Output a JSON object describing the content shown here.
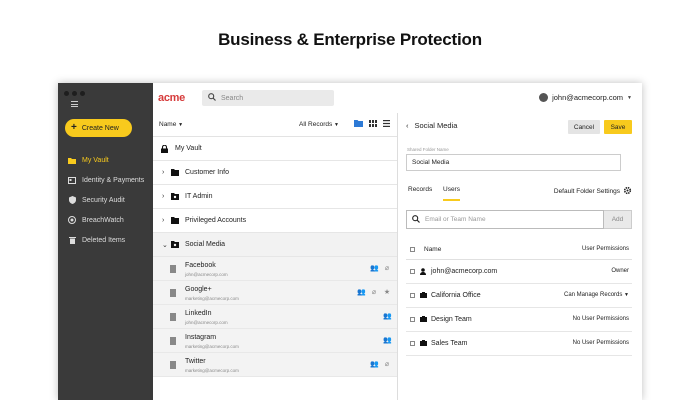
{
  "page_title": "Business & Enterprise Protection",
  "sidebar": {
    "create_label": "Create New",
    "items": [
      {
        "label": "My Vault",
        "icon": "folder-icon",
        "active": true
      },
      {
        "label": "Identity & Payments",
        "icon": "id-card-icon"
      },
      {
        "label": "Security Audit",
        "icon": "shield-icon"
      },
      {
        "label": "BreachWatch",
        "icon": "breachwatch-icon"
      },
      {
        "label": "Deleted Items",
        "icon": "trash-icon"
      }
    ]
  },
  "topbar": {
    "logo": "acme",
    "search_placeholder": "Search",
    "user_email": "john@acmecorp.com"
  },
  "list": {
    "sort_label": "Name",
    "filter_label": "All Records",
    "my_vault": "My Vault",
    "folders": [
      {
        "label": "Customer Info",
        "icon": "folder-icon"
      },
      {
        "label": "IT Admin",
        "icon": "shared-folder-icon"
      },
      {
        "label": "Privileged Accounts",
        "icon": "folder-icon"
      },
      {
        "label": "Social Media",
        "icon": "shared-folder-icon"
      }
    ],
    "records": [
      {
        "title": "Facebook",
        "sub": "john@acmecorp.com"
      },
      {
        "title": "Google+",
        "sub": "marketing@acmecorp.com"
      },
      {
        "title": "LinkedIn",
        "sub": "john@acmecorp.com"
      },
      {
        "title": "Instagram",
        "sub": "marketing@acmecorp.com"
      },
      {
        "title": "Twitter",
        "sub": "marketing@acmecorp.com"
      }
    ]
  },
  "detail": {
    "title": "Social Media",
    "cancel_label": "Cancel",
    "save_label": "Save",
    "field_label": "Shared Folder Name",
    "field_value": "Social Media",
    "tab_records": "Records",
    "tab_users": "Users",
    "default_settings": "Default Folder Settings",
    "email_placeholder": "Email or Team Name",
    "add_label": "Add",
    "col_name": "Name",
    "col_permissions": "User Permissions",
    "users": [
      {
        "name": "john@acmecorp.com",
        "permission": "Owner",
        "icon": "user-icon"
      },
      {
        "name": "California Office",
        "permission": "Can Manage Records",
        "icon": "team-icon"
      },
      {
        "name": "Design Team",
        "permission": "No User Permissions",
        "icon": "team-icon"
      },
      {
        "name": "Sales Team",
        "permission": "No User Permissions",
        "icon": "team-icon"
      }
    ]
  },
  "colors": {
    "accent": "#f8ca1d",
    "sidebar": "#3a3a3a",
    "logo": "#d63b3b",
    "view_active": "#2d7ad6"
  }
}
